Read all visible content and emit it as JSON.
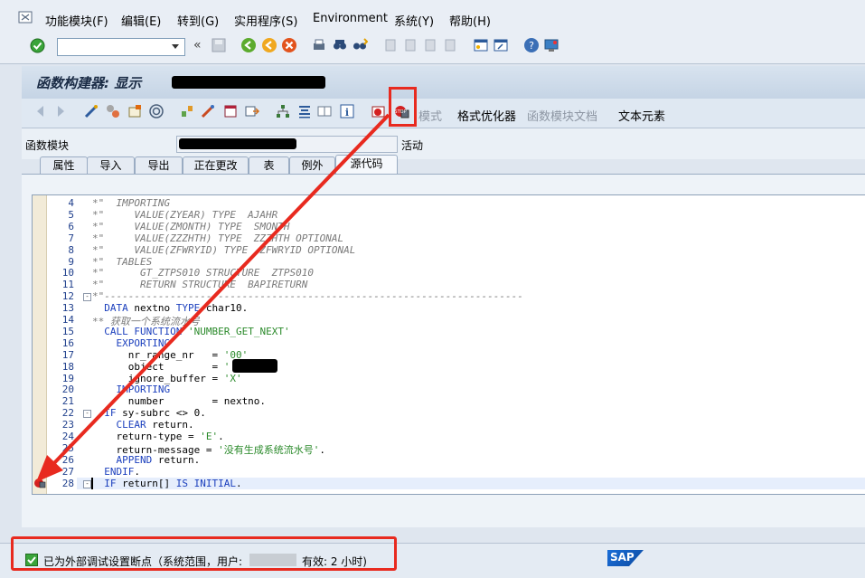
{
  "menu": [
    "功能模块(F)",
    "编辑(E)",
    "转到(G)",
    "实用程序(S)",
    "Environment",
    "系统(Y)",
    "帮助(H)"
  ],
  "title": "函数构建器: 显示",
  "app_toolbar": {
    "mode_label": "模式",
    "pretty_printer_label": "格式优化器",
    "fm_doc_label": "函数模块文档",
    "text_elements_label": "文本元素"
  },
  "fields": {
    "fm_label": "函数模块",
    "status_text": "活动"
  },
  "tabs": [
    "属性",
    "导入",
    "导出",
    "正在更改",
    "表",
    "例外",
    "源代码"
  ],
  "editor": {
    "line_numbers": [
      "4",
      "5",
      "6",
      "7",
      "8",
      "9",
      "10",
      "11",
      "12",
      "13",
      "14",
      "15",
      "16",
      "17",
      "18",
      "19",
      "20",
      "21",
      "22",
      "23",
      "24",
      "25",
      "26",
      "27",
      "28"
    ],
    "lines": [
      {
        "text": "*\"  IMPORTING"
      },
      {
        "text": "*\"     VALUE(ZYEAR) TYPE  AJAHR"
      },
      {
        "text": "*\"     VALUE(ZMONTH) TYPE  SMONTH"
      },
      {
        "text": "*\"     VALUE(ZZZHTH) TYPE  ZZZHTH OPTIONAL"
      },
      {
        "text": "*\"     VALUE(ZFWRYID) TYPE  ZFWRYID OPTIONAL"
      },
      {
        "text": "*\"  TABLES"
      },
      {
        "text": "*\"      GT_ZTPS010 STRUCTURE  ZTPS010"
      },
      {
        "text": "*\"      RETURN STRUCTURE  BAPIRETURN"
      },
      {
        "text": "*\"----------------------------------------------------------------------"
      },
      {
        "text": "  DATA nextno TYPE char10."
      },
      {
        "text": "** 获取一个系统流水号"
      },
      {
        "text": "  CALL FUNCTION 'NUMBER_GET_NEXT'"
      },
      {
        "text": "    EXPORTING"
      },
      {
        "text": "      nr_range_nr   = '00'"
      },
      {
        "text": "      object        = '"
      },
      {
        "text": "      ignore_buffer = 'X'"
      },
      {
        "text": "    IMPORTING"
      },
      {
        "text": "      number        = nextno."
      },
      {
        "text": "  IF sy-subrc <> 0."
      },
      {
        "text": "    CLEAR return."
      },
      {
        "text": "    return-type = 'E'."
      },
      {
        "text": "    return-message = '没有生成系统流水号'."
      },
      {
        "text": "    APPEND return."
      },
      {
        "text": "  ENDIF."
      },
      {
        "text": "  IF return[] IS INITIAL."
      }
    ]
  },
  "status": {
    "text_prefix": "已为外部调试设置断点（系统范围，用户:",
    "text_suffix": "有效: 2 小时)"
  },
  "brand": "SAP",
  "colors": {
    "annotation_red": "#e82a1f",
    "comment_gray": "#7a7a7a",
    "keyword_blue": "#1b3fbd",
    "string_green": "#2b8a2b"
  }
}
